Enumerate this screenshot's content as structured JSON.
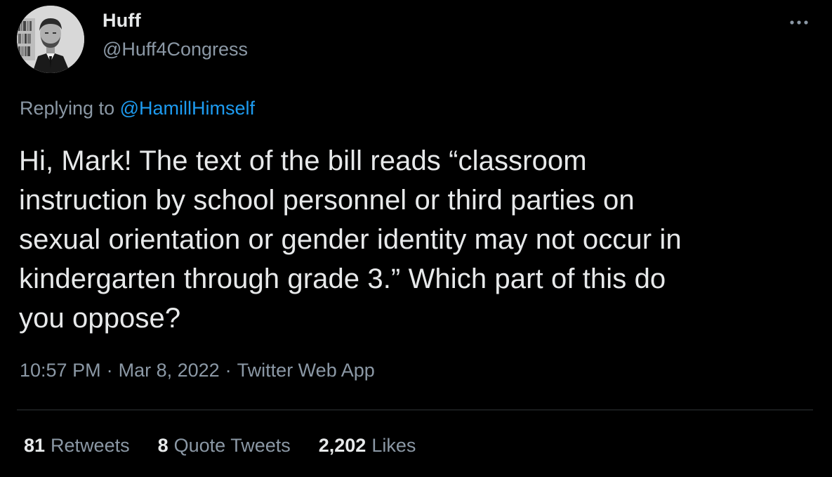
{
  "author": {
    "display_name": "Huff",
    "handle": "@Huff4Congress",
    "avatar_icon": "profile-photo"
  },
  "more_icon": "more-options-icon",
  "reply": {
    "prefix": "Replying to",
    "mention": "@HamillHimself"
  },
  "tweet": {
    "lines": [
      "Hi, Mark! The text of the bill reads “classroom",
      "instruction by school personnel or third parties on",
      "sexual orientation or gender identity may not occur in",
      "kindergarten through grade 3.” Which part of this do",
      "you oppose?"
    ]
  },
  "meta": {
    "time": "10:57 PM",
    "separator": "·",
    "date": "Mar 8, 2022",
    "source": "Twitter Web App"
  },
  "stats": {
    "retweets_count": "81",
    "retweets_label": "Retweets",
    "quotes_count": "8",
    "quotes_label": "Quote Tweets",
    "likes_count": "2,202",
    "likes_label": "Likes"
  },
  "colors": {
    "background": "#000000",
    "primary_text": "#e7e9ea",
    "secondary_text": "#8b98a5",
    "link": "#1d9bf0",
    "divider": "#2f3336"
  }
}
